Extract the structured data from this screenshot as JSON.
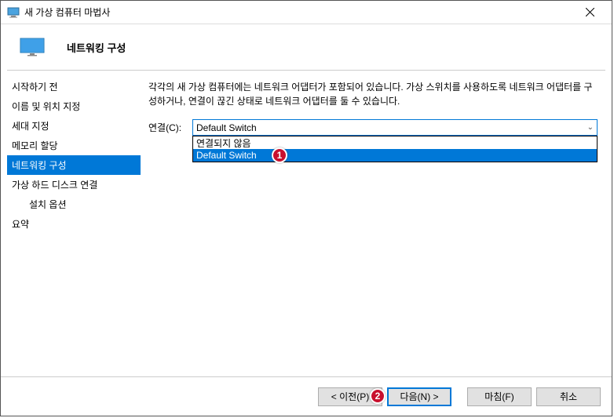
{
  "window": {
    "title": "새 가상 컴퓨터 마법사"
  },
  "header": {
    "page_title": "네트워킹 구성"
  },
  "sidebar": {
    "items": [
      {
        "label": "시작하기 전",
        "active": false
      },
      {
        "label": "이름 및 위치 지정",
        "active": false
      },
      {
        "label": "세대 지정",
        "active": false
      },
      {
        "label": "메모리 할당",
        "active": false
      },
      {
        "label": "네트워킹 구성",
        "active": true
      },
      {
        "label": "가상 하드 디스크 연결",
        "active": false
      },
      {
        "label": "설치 옵션",
        "active": false,
        "indent": true
      },
      {
        "label": "요약",
        "active": false
      }
    ]
  },
  "main": {
    "description": "각각의 새 가상 컴퓨터에는 네트워크 어댑터가 포함되어 있습니다. 가상 스위치를 사용하도록 네트워크 어댑터를 구성하거나, 연결이 끊긴 상태로 네트워크 어댑터를 둘 수 있습니다.",
    "connection_label": "연결(C):",
    "combo_value": "Default Switch",
    "dropdown": {
      "options": [
        {
          "label": "연결되지 않음",
          "selected": false
        },
        {
          "label": "Default Switch",
          "selected": true
        }
      ]
    }
  },
  "footer": {
    "prev_label": "< 이전(P)",
    "next_label": "다음(N) >",
    "finish_label": "마침(F)",
    "cancel_label": "취소"
  },
  "markers": {
    "m1": "1",
    "m2": "2"
  }
}
